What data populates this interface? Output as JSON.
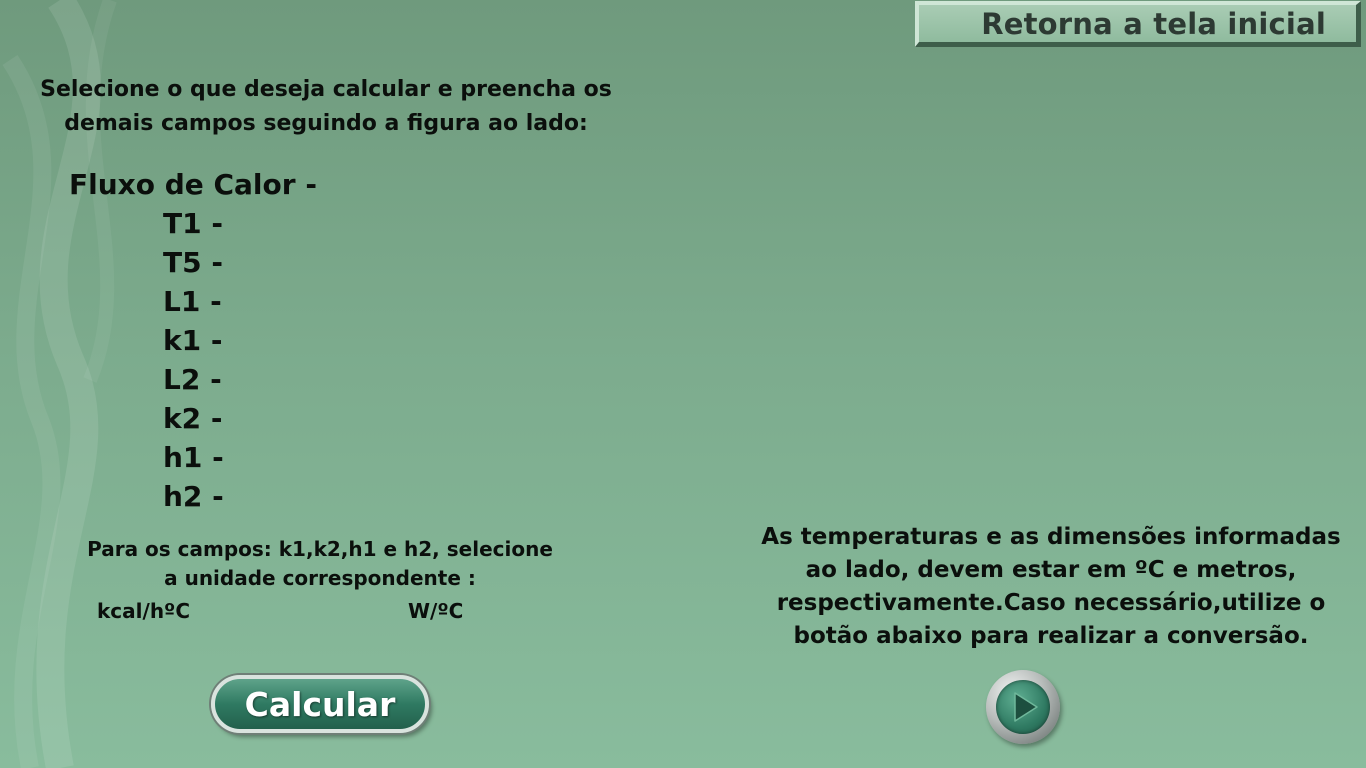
{
  "header": {
    "home_button_label": "Retorna a tela inicial"
  },
  "instruction": {
    "line1": "Selecione o que deseja calcular e preencha os",
    "line2": "demais campos seguindo a figura ao lado:"
  },
  "fields": [
    {
      "label": "Fluxo de Calor -"
    },
    {
      "label": "T1 -"
    },
    {
      "label": "T5 -"
    },
    {
      "label": "L1 -"
    },
    {
      "label": "k1 -"
    },
    {
      "label": "L2 -"
    },
    {
      "label": "k2 -"
    },
    {
      "label": "h1 -"
    },
    {
      "label": "h2 -"
    }
  ],
  "units": {
    "note_line1": "Para os campos: k1,k2,h1 e h2, selecione",
    "note_line2": "a unidade correspondente :",
    "option1": "kcal/hºC",
    "option2": "W/ºC"
  },
  "calculate_button_label": "Calcular",
  "info": {
    "line1": "As temperaturas e as dimensões informadas",
    "line2": "ao lado, devem estar em ºC e metros,",
    "line3": "respectivamente.Caso necessário,utilize o",
    "line4": "botão abaixo para realizar a conversão."
  },
  "conversion_button_icon": "play-icon",
  "colors": {
    "background_top": "#6f9a7d",
    "background_bottom": "#89bc9d",
    "button_green": "#2f7a62",
    "text": "#0b0f0c"
  }
}
